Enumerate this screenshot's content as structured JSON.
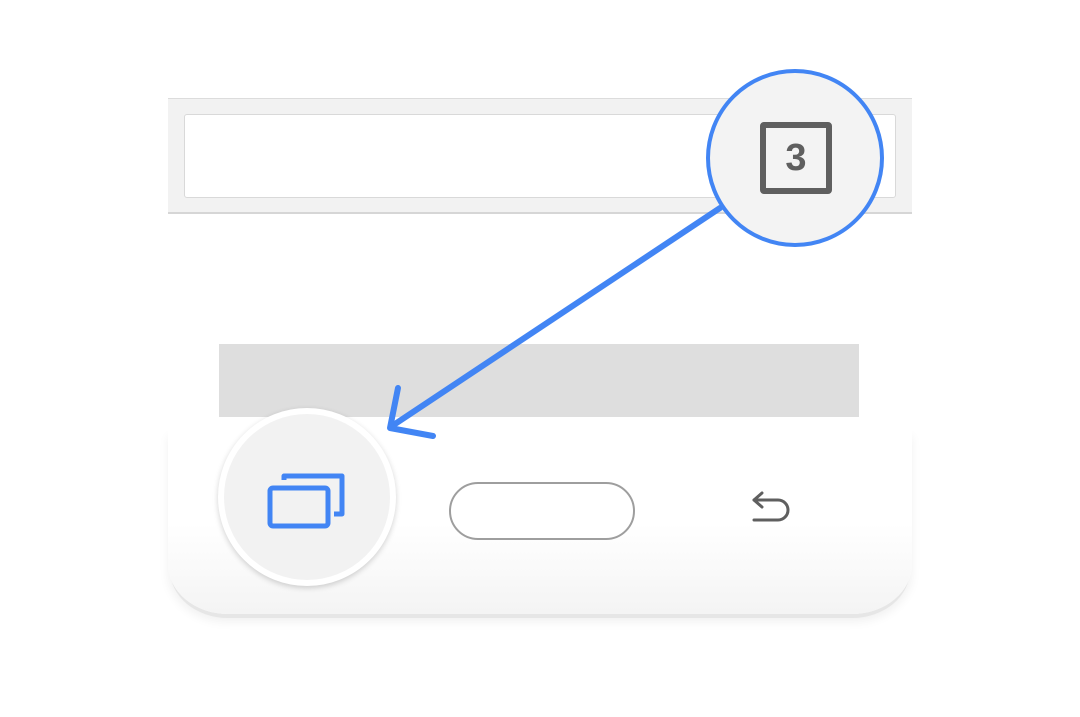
{
  "callout": {
    "tab_count": "3",
    "icon": "tab-count-icon"
  },
  "nav_bar": {
    "recents": {
      "icon": "recents-icon"
    },
    "home": {
      "icon": "home-pill-icon"
    },
    "back": {
      "icon": "back-arrow-icon"
    }
  },
  "colors": {
    "accent": "#4285f4",
    "badge": "#5f5f5f",
    "toolbar": "#f2f2f2",
    "content_bar": "#dedede",
    "home_outline": "#9e9e9e"
  }
}
